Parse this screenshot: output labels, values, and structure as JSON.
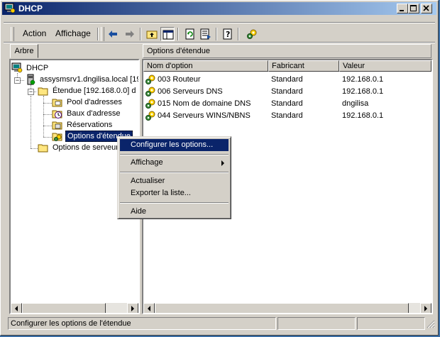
{
  "window": {
    "title": "DHCP"
  },
  "menu": {
    "action": "Action",
    "affichage": "Affichage"
  },
  "tree_tab": "Arbre",
  "tree": {
    "root": "DHCP",
    "server": "assysmsrv1.dngilisa.local [19",
    "scope": "Étendue [192.168.0.0] d",
    "pool": "Pool d'adresses",
    "leases": "Baux d'adresse",
    "reservations": "Réservations",
    "scope_options": "Options d'étendue",
    "server_options": "Options de serveur"
  },
  "list": {
    "header": "Options d'étendue",
    "columns": [
      "Nom d'option",
      "Fabricant",
      "Valeur"
    ],
    "rows": [
      {
        "name": "003 Routeur",
        "vendor": "Standard",
        "value": "192.168.0.1"
      },
      {
        "name": "006 Serveurs DNS",
        "vendor": "Standard",
        "value": "192.168.0.1"
      },
      {
        "name": "015 Nom de domaine DNS",
        "vendor": "Standard",
        "value": "dngilisa"
      },
      {
        "name": "044 Serveurs WINS/NBNS",
        "vendor": "Standard",
        "value": "192.168.0.1"
      }
    ]
  },
  "context_menu": {
    "configure": "Configurer les options...",
    "view": "Affichage",
    "refresh": "Actualiser",
    "export": "Exporter la liste...",
    "help": "Aide"
  },
  "status": {
    "text": "Configurer les options de l'étendue"
  },
  "colors": {
    "titlebar": "#0a246a",
    "selection": "#0a246a",
    "face": "#d4d0c8"
  }
}
